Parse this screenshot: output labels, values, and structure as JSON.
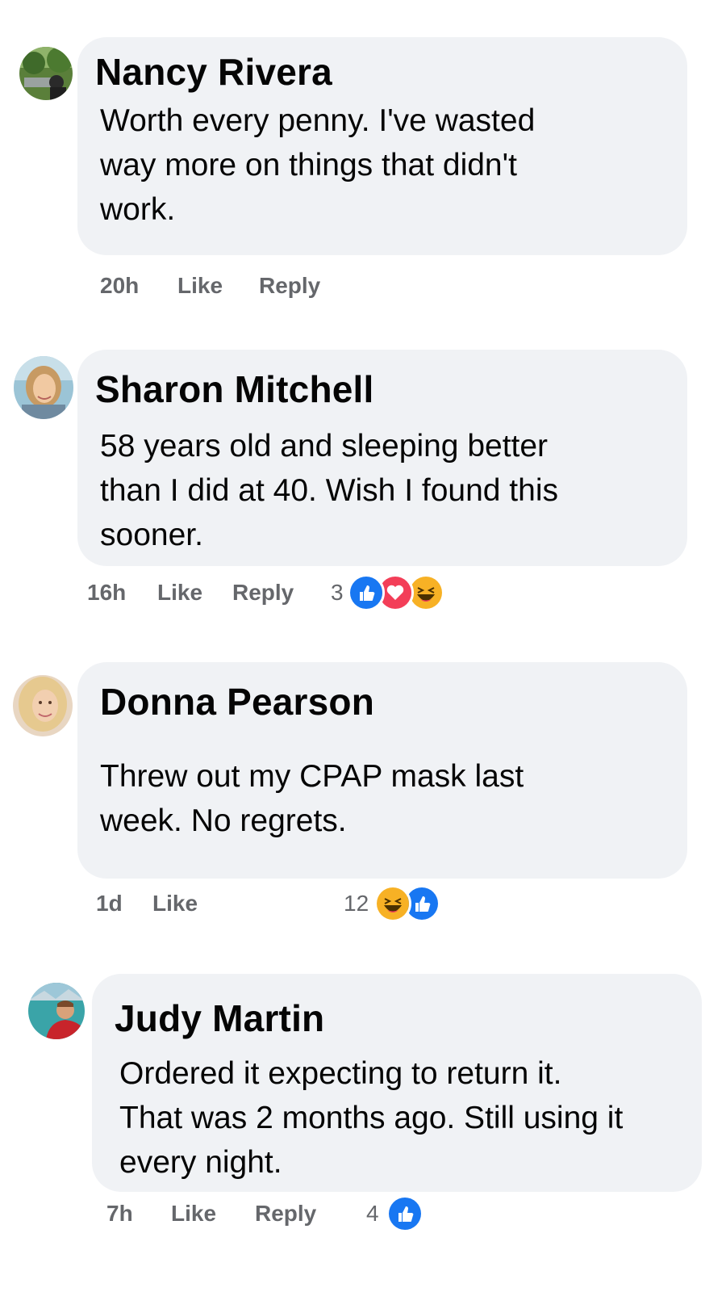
{
  "comments": [
    {
      "name": "Nancy Rivera",
      "lines": [
        "Worth every penny. I've wasted",
        "way more on things that didn't",
        "work."
      ],
      "time": "20h",
      "like": "Like",
      "reply": "Reply",
      "reaction_count": "",
      "reactions": []
    },
    {
      "name": "Sharon Mitchell",
      "lines": [
        "58 years old and sleeping better",
        "than I did at 40. Wish I found this",
        "sooner."
      ],
      "time": "16h",
      "like": "Like",
      "reply": "Reply",
      "reaction_count": "3",
      "reactions": [
        "like-icon",
        "love-icon",
        "haha-icon"
      ]
    },
    {
      "name": "Donna Pearson",
      "lines": [
        "Threw out my CPAP mask last",
        "week. No regrets."
      ],
      "time": "1d",
      "like": "Like",
      "reply": "",
      "reaction_count": "12",
      "reactions": [
        "haha-icon",
        "like-icon"
      ]
    },
    {
      "name": "Judy Martin",
      "lines": [
        "Ordered it expecting to return it.",
        "That was 2 months ago. Still using it",
        "every night."
      ],
      "time": "7h",
      "like": "Like",
      "reply": "Reply",
      "reaction_count": "4",
      "reactions": [
        "like-icon"
      ]
    }
  ],
  "colors": {
    "bubble": "#f0f2f5",
    "meta_text": "#65676b",
    "like_blue": "#1877f2",
    "love_red": "#f33e58",
    "haha_yellow": "#f7b125"
  }
}
